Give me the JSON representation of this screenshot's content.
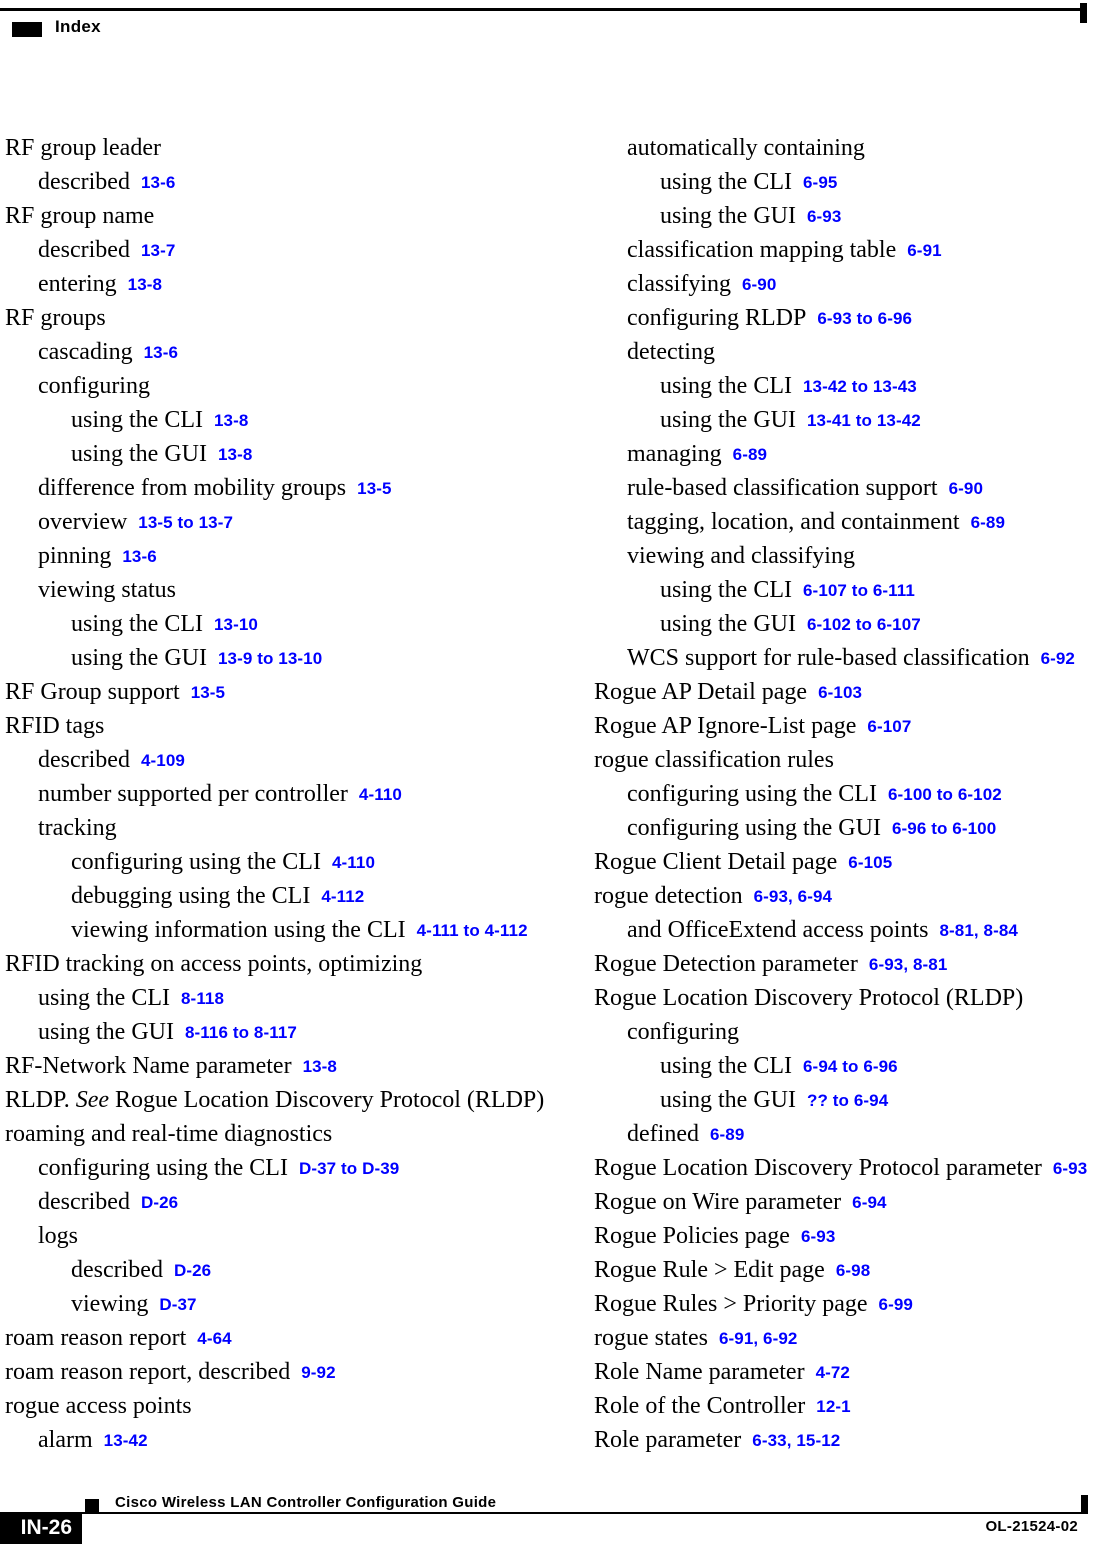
{
  "header": {
    "label": "Index"
  },
  "footer": {
    "page_number": "IN-26",
    "guide_title": "Cisco Wireless LAN Controller Configuration Guide",
    "doc_number": "OL-21524-02"
  },
  "colors": {
    "page_reference": "#0000ff",
    "text": "#000000",
    "rule": "#000000"
  },
  "columns": {
    "left": [
      {
        "level": 0,
        "term": "RF group leader",
        "ref": ""
      },
      {
        "level": 1,
        "term": "described",
        "ref": "13-6"
      },
      {
        "level": 0,
        "term": "RF group name",
        "ref": ""
      },
      {
        "level": 1,
        "term": "described",
        "ref": "13-7"
      },
      {
        "level": 1,
        "term": "entering",
        "ref": "13-8"
      },
      {
        "level": 0,
        "term": "RF groups",
        "ref": ""
      },
      {
        "level": 1,
        "term": "cascading",
        "ref": "13-6"
      },
      {
        "level": 1,
        "term": "configuring",
        "ref": ""
      },
      {
        "level": 2,
        "term": "using the CLI",
        "ref": "13-8"
      },
      {
        "level": 2,
        "term": "using the GUI",
        "ref": "13-8"
      },
      {
        "level": 1,
        "term": "difference from mobility groups",
        "ref": "13-5"
      },
      {
        "level": 1,
        "term": "overview",
        "ref": "13-5 to 13-7"
      },
      {
        "level": 1,
        "term": "pinning",
        "ref": "13-6"
      },
      {
        "level": 1,
        "term": "viewing status",
        "ref": ""
      },
      {
        "level": 2,
        "term": "using the CLI",
        "ref": "13-10"
      },
      {
        "level": 2,
        "term": "using the GUI",
        "ref": "13-9 to 13-10"
      },
      {
        "level": 0,
        "term": "RF Group support",
        "ref": "13-5"
      },
      {
        "level": 0,
        "term": "RFID tags",
        "ref": ""
      },
      {
        "level": 1,
        "term": "described",
        "ref": "4-109"
      },
      {
        "level": 1,
        "term": "number supported per controller",
        "ref": "4-110"
      },
      {
        "level": 1,
        "term": "tracking",
        "ref": ""
      },
      {
        "level": 2,
        "term": "configuring using the CLI",
        "ref": "4-110"
      },
      {
        "level": 2,
        "term": "debugging using the CLI",
        "ref": "4-112"
      },
      {
        "level": 2,
        "term": "viewing information using the CLI",
        "ref": "4-111 to 4-112"
      },
      {
        "level": 0,
        "term": "RFID tracking on access points, optimizing",
        "ref": ""
      },
      {
        "level": 1,
        "term": "using the CLI",
        "ref": "8-118"
      },
      {
        "level": 1,
        "term": "using the GUI",
        "ref": "8-116 to 8-117"
      },
      {
        "level": 0,
        "term": "RF-Network Name parameter",
        "ref": "13-8"
      },
      {
        "level": 0,
        "term": "RLDP. ",
        "term_italic": "See",
        "term_after": " Rogue Location Discovery Protocol (RLDP)",
        "ref": ""
      },
      {
        "level": 0,
        "term": "roaming and real-time diagnostics",
        "ref": ""
      },
      {
        "level": 1,
        "term": "configuring using the CLI",
        "ref": "D-37 to D-39"
      },
      {
        "level": 1,
        "term": "described",
        "ref": "D-26"
      },
      {
        "level": 1,
        "term": "logs",
        "ref": ""
      },
      {
        "level": 2,
        "term": "described",
        "ref": "D-26"
      },
      {
        "level": 2,
        "term": "viewing",
        "ref": "D-37"
      },
      {
        "level": 0,
        "term": "roam reason report",
        "ref": "4-64"
      },
      {
        "level": 0,
        "term": "roam reason report, described",
        "ref": "9-92"
      },
      {
        "level": 0,
        "term": "rogue access points",
        "ref": ""
      },
      {
        "level": 1,
        "term": "alarm",
        "ref": "13-42"
      }
    ],
    "right": [
      {
        "level": 1,
        "term": "automatically containing",
        "ref": ""
      },
      {
        "level": 2,
        "term": "using the CLI",
        "ref": "6-95"
      },
      {
        "level": 2,
        "term": "using the GUI",
        "ref": "6-93"
      },
      {
        "level": 1,
        "term": "classification mapping table",
        "ref": "6-91"
      },
      {
        "level": 1,
        "term": "classifying",
        "ref": "6-90"
      },
      {
        "level": 1,
        "term": "configuring RLDP",
        "ref": "6-93 to 6-96"
      },
      {
        "level": 1,
        "term": "detecting",
        "ref": ""
      },
      {
        "level": 2,
        "term": "using the CLI",
        "ref": "13-42 to 13-43"
      },
      {
        "level": 2,
        "term": "using the GUI",
        "ref": "13-41 to 13-42"
      },
      {
        "level": 1,
        "term": "managing",
        "ref": "6-89"
      },
      {
        "level": 1,
        "term": "rule-based classification support",
        "ref": "6-90"
      },
      {
        "level": 1,
        "term": "tagging, location, and containment",
        "ref": "6-89"
      },
      {
        "level": 1,
        "term": "viewing and classifying",
        "ref": ""
      },
      {
        "level": 2,
        "term": "using the CLI",
        "ref": "6-107 to 6-111"
      },
      {
        "level": 2,
        "term": "using the GUI",
        "ref": "6-102 to 6-107"
      },
      {
        "level": 1,
        "term": "WCS support for rule-based classification",
        "ref": "6-92"
      },
      {
        "level": 0,
        "term": "Rogue AP Detail page",
        "ref": "6-103"
      },
      {
        "level": 0,
        "term": "Rogue AP Ignore-List page",
        "ref": "6-107"
      },
      {
        "level": 0,
        "term": "rogue classification rules",
        "ref": ""
      },
      {
        "level": 1,
        "term": "configuring using the CLI",
        "ref": "6-100 to 6-102"
      },
      {
        "level": 1,
        "term": "configuring using the GUI",
        "ref": "6-96 to 6-100"
      },
      {
        "level": 0,
        "term": "Rogue Client Detail page",
        "ref": "6-105"
      },
      {
        "level": 0,
        "term": "rogue detection",
        "ref": "6-93, 6-94"
      },
      {
        "level": 1,
        "term": "and OfficeExtend access points",
        "ref": "8-81, 8-84"
      },
      {
        "level": 0,
        "term": "Rogue Detection parameter",
        "ref": "6-93, 8-81"
      },
      {
        "level": 0,
        "term": "Rogue Location Discovery Protocol (RLDP)",
        "ref": ""
      },
      {
        "level": 1,
        "term": "configuring",
        "ref": ""
      },
      {
        "level": 2,
        "term": "using the CLI",
        "ref": "6-94 to 6-96"
      },
      {
        "level": 2,
        "term": "using the GUI",
        "ref": "?? to 6-94"
      },
      {
        "level": 1,
        "term": "defined",
        "ref": "6-89"
      },
      {
        "level": 0,
        "term": "Rogue Location Discovery Protocol parameter",
        "ref": "6-93"
      },
      {
        "level": 0,
        "term": "Rogue on Wire parameter",
        "ref": "6-94"
      },
      {
        "level": 0,
        "term": "Rogue Policies page",
        "ref": "6-93"
      },
      {
        "level": 0,
        "term": "Rogue Rule > Edit page",
        "ref": "6-98"
      },
      {
        "level": 0,
        "term": "Rogue Rules > Priority page",
        "ref": "6-99"
      },
      {
        "level": 0,
        "term": "rogue states",
        "ref": "6-91, 6-92"
      },
      {
        "level": 0,
        "term": "Role Name parameter",
        "ref": "4-72"
      },
      {
        "level": 0,
        "term": "Role of the Controller",
        "ref": "12-1"
      },
      {
        "level": 0,
        "term": "Role parameter",
        "ref": "6-33, 15-12"
      }
    ]
  }
}
